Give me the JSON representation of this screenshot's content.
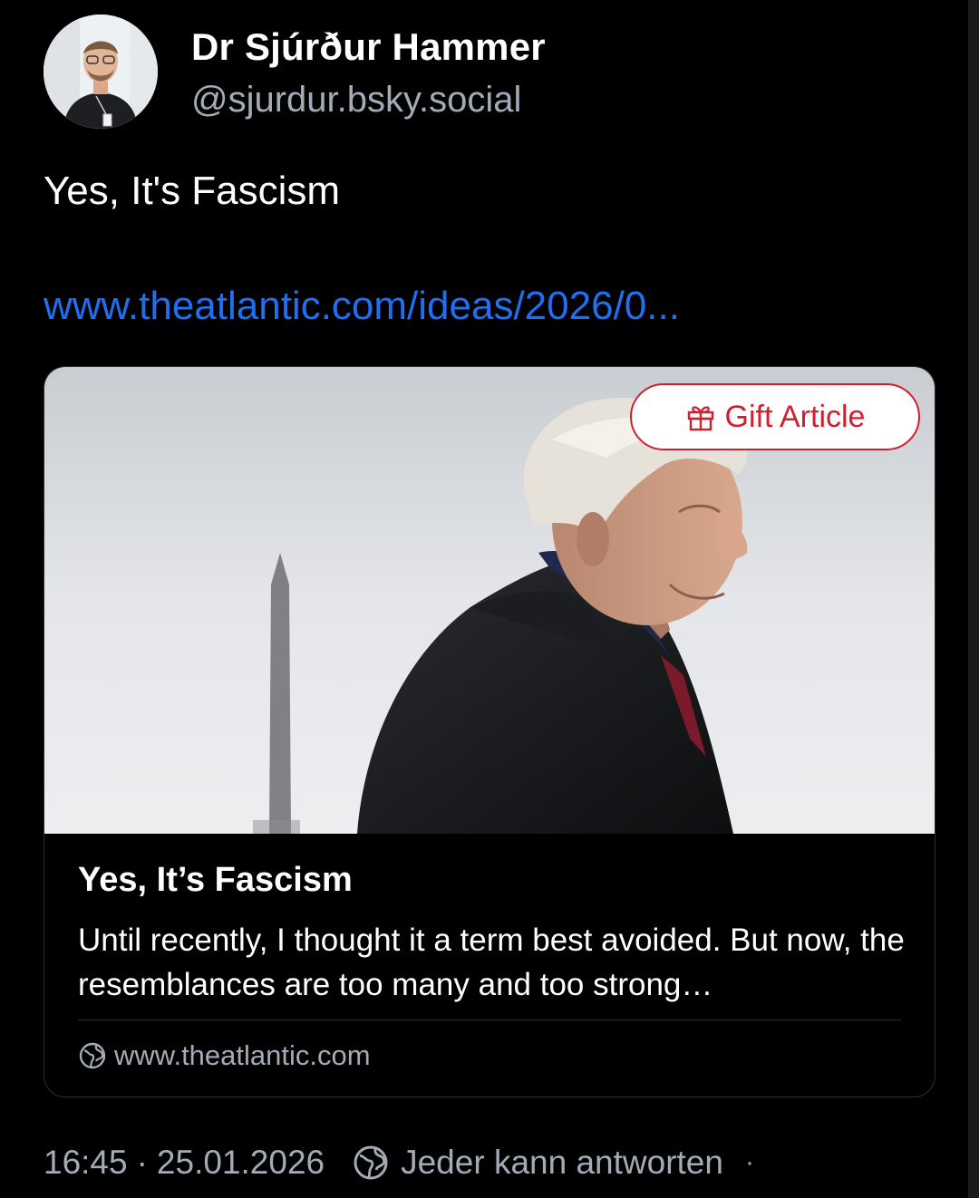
{
  "author": {
    "display_name": "Dr Sjúrður Hammer",
    "handle": "@sjurdur.bsky.social"
  },
  "post": {
    "text": "Yes, It's Fascism",
    "link_text": "www.theatlantic.com/ideas/2026/0..."
  },
  "card": {
    "gift_label": "Gift Article",
    "title": "Yes, It’s Fascism",
    "description": "Until recently, I thought it a term best avoided. But now, the resemblances are too many and too strong…",
    "domain": "www.theatlantic.com"
  },
  "footer": {
    "time": "16:45",
    "separator": "·",
    "date": "25.01.2026",
    "reply_setting": "Jeder kann antworten",
    "trailing_dot": "·"
  },
  "icons": {
    "gift": "gift-icon",
    "globe": "globe-icon"
  },
  "colors": {
    "background": "#000000",
    "link": "#1f6ff0",
    "muted": "#a3acb6",
    "gift_accent": "#d21f2d"
  }
}
